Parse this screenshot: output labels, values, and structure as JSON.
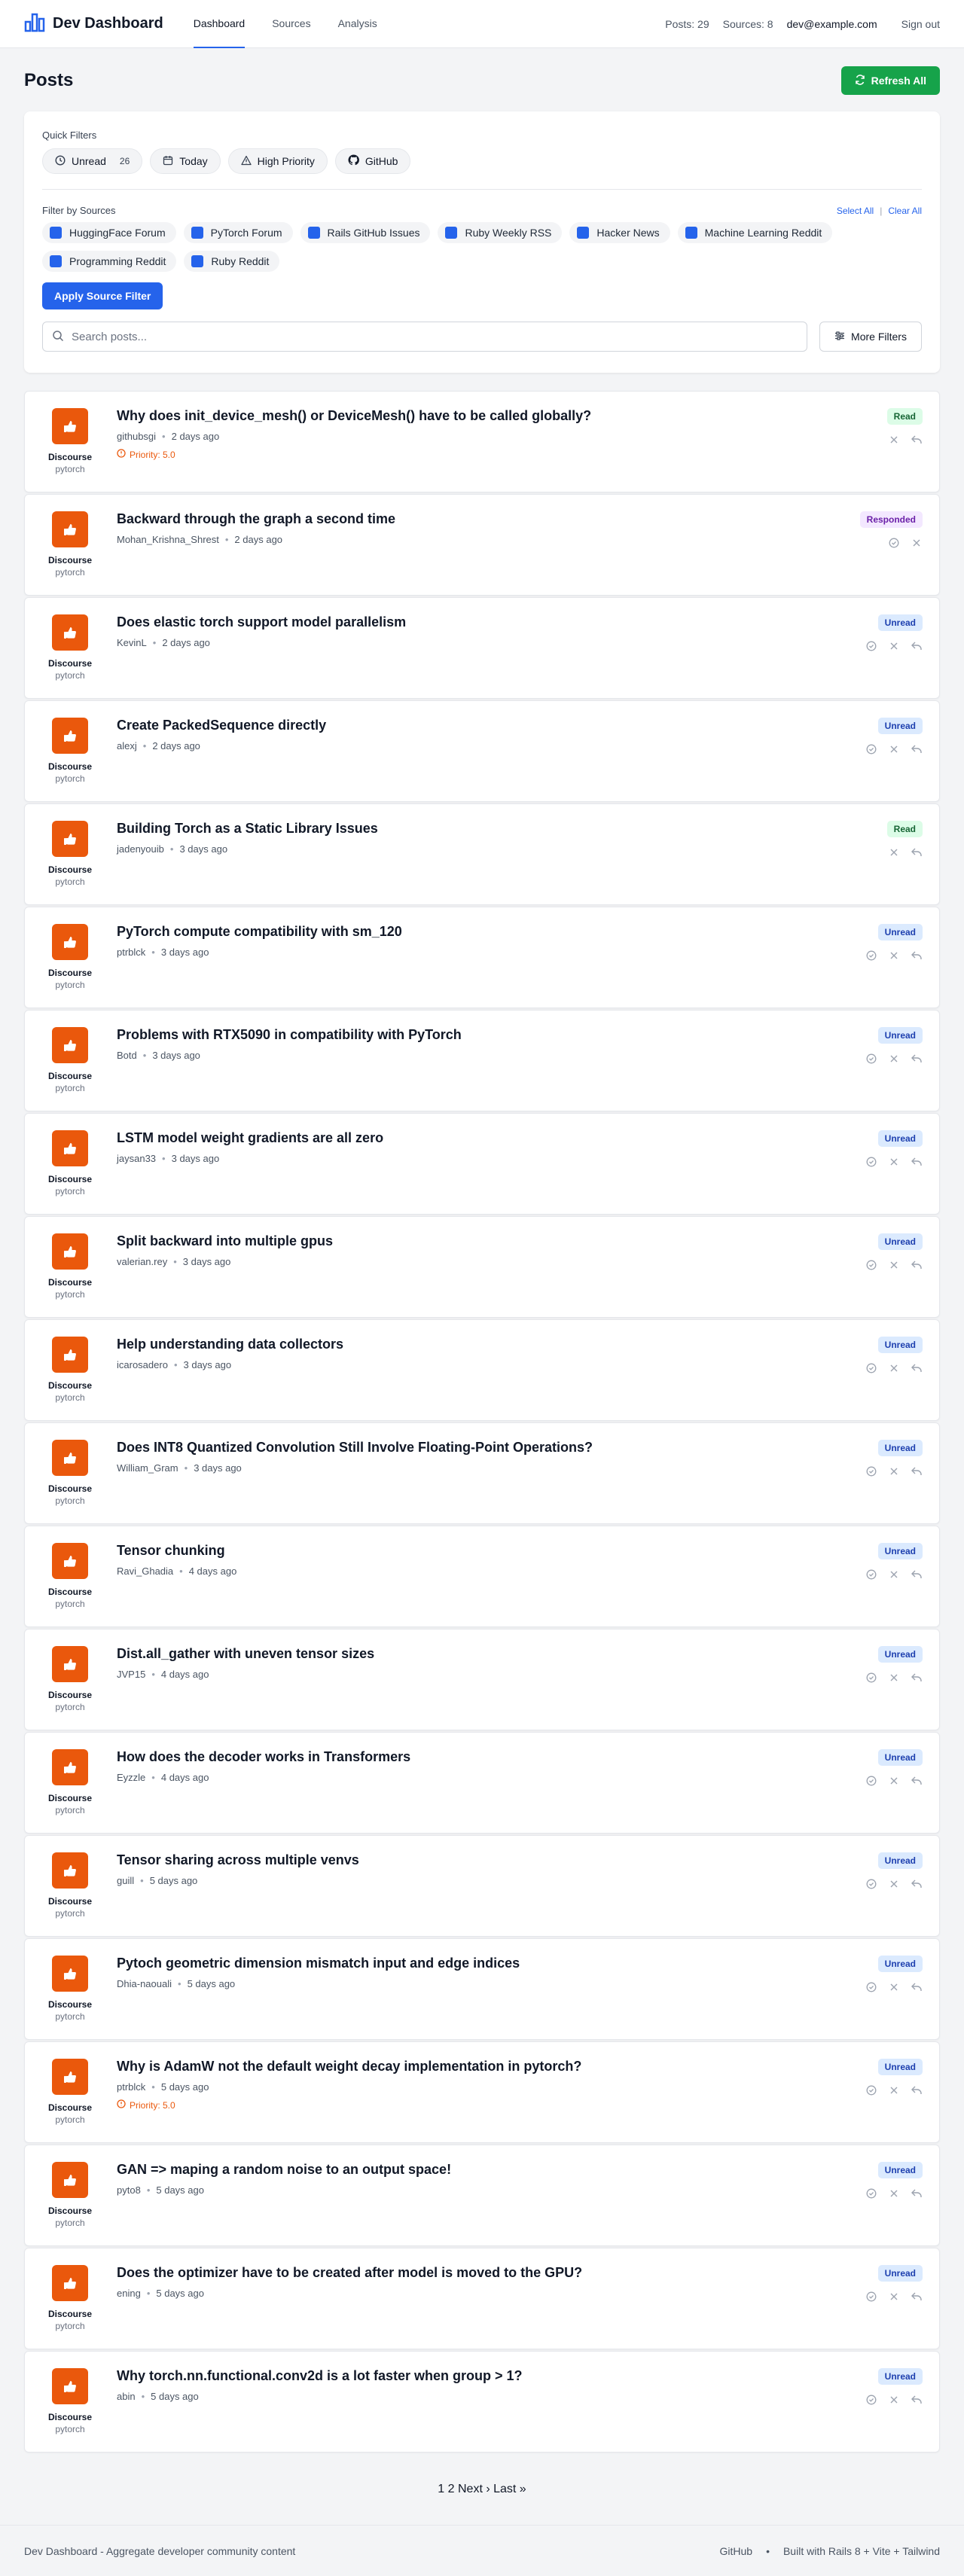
{
  "nav": {
    "brand": "Dev Dashboard",
    "links": [
      "Dashboard",
      "Sources",
      "Analysis"
    ],
    "posts_count": "Posts: 29",
    "sources_count": "Sources: 8",
    "email": "dev@example.com",
    "signout": "Sign out"
  },
  "header": {
    "title": "Posts",
    "refresh_label": "Refresh All"
  },
  "filters": {
    "quick_label": "Quick Filters",
    "quick": [
      {
        "label": "Unread",
        "count": "26",
        "icon": "clock-icon"
      },
      {
        "label": "Today",
        "icon": "calendar-icon"
      },
      {
        "label": "High Priority",
        "icon": "warning-icon"
      },
      {
        "label": "GitHub",
        "icon": "github-icon"
      }
    ],
    "sources_label": "Filter by Sources",
    "select_all": "Select All",
    "clear_all": "Clear All",
    "sources": [
      "HuggingFace Forum",
      "PyTorch Forum",
      "Rails GitHub Issues",
      "Ruby Weekly RSS",
      "Hacker News",
      "Machine Learning Reddit",
      "Programming Reddit",
      "Ruby Reddit"
    ],
    "apply_label": "Apply Source Filter",
    "search_placeholder": "Search posts...",
    "more_label": "More Filters"
  },
  "posts": [
    {
      "title": "Why does init_device_mesh() or DeviceMesh() have to be called globally?",
      "author": "githubsgi",
      "time": "2 days ago",
      "status": "Read",
      "priority": "Priority: 5.0",
      "source": "Discourse",
      "source_sub": "pytorch"
    },
    {
      "title": "Backward through the graph a second time",
      "author": "Mohan_Krishna_Shrest",
      "time": "2 days ago",
      "status": "Responded",
      "source": "Discourse",
      "source_sub": "pytorch"
    },
    {
      "title": "Does elastic torch support model parallelism",
      "author": "KevinL",
      "time": "2 days ago",
      "status": "Unread",
      "source": "Discourse",
      "source_sub": "pytorch"
    },
    {
      "title": "Create PackedSequence directly",
      "author": "alexj",
      "time": "2 days ago",
      "status": "Unread",
      "source": "Discourse",
      "source_sub": "pytorch"
    },
    {
      "title": "Building Torch as a Static Library Issues",
      "author": "jadenyouib",
      "time": "3 days ago",
      "status": "Read",
      "source": "Discourse",
      "source_sub": "pytorch"
    },
    {
      "title": "PyTorch compute compatibility with sm_120",
      "author": "ptrblck",
      "time": "3 days ago",
      "status": "Unread",
      "source": "Discourse",
      "source_sub": "pytorch"
    },
    {
      "title": "Problems with RTX5090 in compatibility with PyTorch",
      "author": "Botd",
      "time": "3 days ago",
      "status": "Unread",
      "source": "Discourse",
      "source_sub": "pytorch"
    },
    {
      "title": "LSTM model weight gradients are all zero",
      "author": "jaysan33",
      "time": "3 days ago",
      "status": "Unread",
      "source": "Discourse",
      "source_sub": "pytorch"
    },
    {
      "title": "Split backward into multiple gpus",
      "author": "valerian.rey",
      "time": "3 days ago",
      "status": "Unread",
      "source": "Discourse",
      "source_sub": "pytorch"
    },
    {
      "title": "Help understanding data collectors",
      "author": "icarosadero",
      "time": "3 days ago",
      "status": "Unread",
      "source": "Discourse",
      "source_sub": "pytorch"
    },
    {
      "title": "Does INT8 Quantized Convolution Still Involve Floating-Point Operations?",
      "author": "William_Gram",
      "time": "3 days ago",
      "status": "Unread",
      "source": "Discourse",
      "source_sub": "pytorch"
    },
    {
      "title": "Tensor chunking",
      "author": "Ravi_Ghadia",
      "time": "4 days ago",
      "status": "Unread",
      "source": "Discourse",
      "source_sub": "pytorch"
    },
    {
      "title": "Dist.all_gather with uneven tensor sizes",
      "author": "JVP15",
      "time": "4 days ago",
      "status": "Unread",
      "source": "Discourse",
      "source_sub": "pytorch"
    },
    {
      "title": "How does the decoder works in Transformers",
      "author": "Eyzzle",
      "time": "4 days ago",
      "status": "Unread",
      "source": "Discourse",
      "source_sub": "pytorch"
    },
    {
      "title": "Tensor sharing across multiple venvs",
      "author": "guill",
      "time": "5 days ago",
      "status": "Unread",
      "source": "Discourse",
      "source_sub": "pytorch"
    },
    {
      "title": "Pytoch geometric dimension mismatch input and edge indices",
      "author": "Dhia-naouali",
      "time": "5 days ago",
      "status": "Unread",
      "source": "Discourse",
      "source_sub": "pytorch"
    },
    {
      "title": "Why is AdamW not the default weight decay implementation in pytorch?",
      "author": "ptrblck",
      "time": "5 days ago",
      "status": "Unread",
      "priority": "Priority: 5.0",
      "source": "Discourse",
      "source_sub": "pytorch"
    },
    {
      "title": "GAN => maping a random noise to an output space!",
      "author": "pyto8",
      "time": "5 days ago",
      "status": "Unread",
      "source": "Discourse",
      "source_sub": "pytorch"
    },
    {
      "title": "Does the optimizer have to be created after model is moved to the GPU?",
      "author": "ening",
      "time": "5 days ago",
      "status": "Unread",
      "source": "Discourse",
      "source_sub": "pytorch"
    },
    {
      "title": "Why torch.nn.functional.conv2d is a lot faster when group > 1?",
      "author": "abin",
      "time": "5 days ago",
      "status": "Unread",
      "source": "Discourse",
      "source_sub": "pytorch"
    }
  ],
  "pagination": "1 2 Next › Last »",
  "footer": {
    "left": "Dev Dashboard - Aggregate developer community content",
    "github": "GitHub",
    "built": "Built with Rails 8 + Vite + Tailwind"
  },
  "colors": {
    "accent": "#2563eb",
    "refresh": "#16a34a",
    "source_logo": "#ea580c"
  }
}
